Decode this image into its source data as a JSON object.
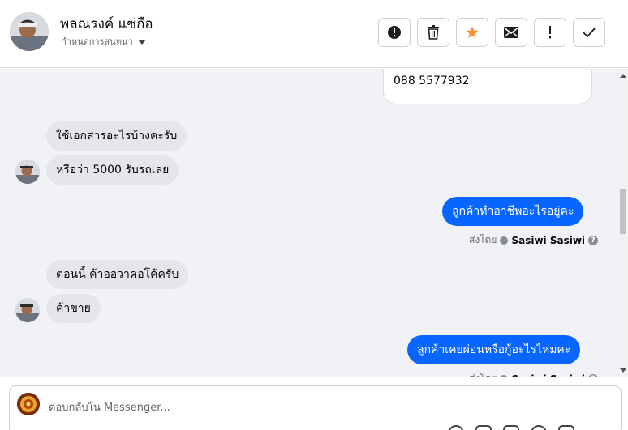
{
  "header": {
    "contact_name": "พลณรงค์ แซ่กือ",
    "subtitle": "กำหนดการสนทนา",
    "actions": [
      {
        "name": "report-button",
        "icon": "exclamation-circle-icon"
      },
      {
        "name": "delete-button",
        "icon": "trash-icon"
      },
      {
        "name": "star-button",
        "icon": "star-icon"
      },
      {
        "name": "mark-unread-button",
        "icon": "envelope-icon"
      },
      {
        "name": "follow-up-button",
        "icon": "exclamation-icon"
      },
      {
        "name": "mark-done-button",
        "icon": "check-icon"
      }
    ]
  },
  "colors": {
    "accent": "#0866ff",
    "star": "#f7923b",
    "incoming_bubble": "#e4e6eb",
    "thread_background": "#f0f2f5"
  },
  "thread": {
    "card_phone": "088 5577932",
    "messages": [
      {
        "direction": "in",
        "text": "ใช้เอกสารอะไรบ้างคะรับ"
      },
      {
        "direction": "in",
        "text": "หรือว่า 5000 รับรถเลย"
      },
      {
        "direction": "out",
        "text": "ลูกค้าทำอาชีพอะไรอยู่คะ"
      },
      {
        "direction": "in",
        "text": "ตอนนี้ ค้าออวาคอโค้ครับ"
      },
      {
        "direction": "in",
        "text": "ค้าขาย"
      },
      {
        "direction": "out",
        "text": "ลูกค้าเคยผ่อนหรือกู้อะไรไหมคะ"
      }
    ],
    "sent_by_label": "ส่งโดย",
    "sent_by_name": "Sasiwi Sasiwi"
  },
  "composer": {
    "placeholder": "ตอบกลับใน Messenger..."
  }
}
